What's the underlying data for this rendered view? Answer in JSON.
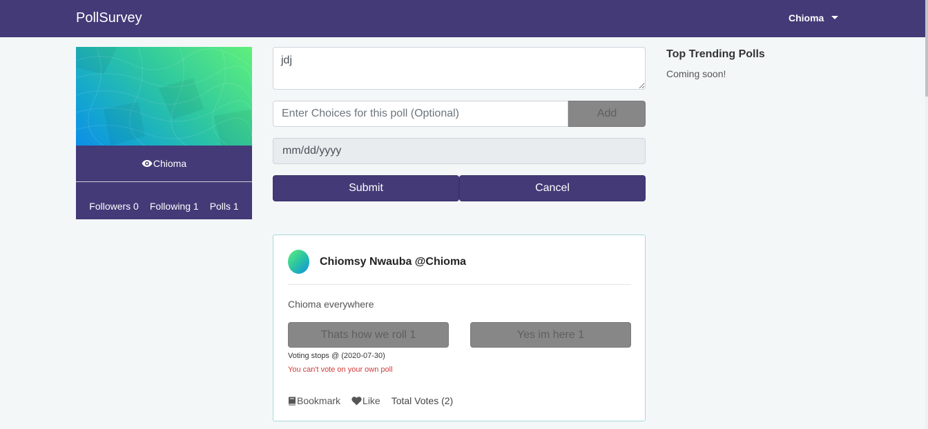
{
  "navbar": {
    "brand": "PollSurvey",
    "user": "Chioma",
    "bg_color": "#433a77"
  },
  "profile": {
    "name": "Chioma",
    "name_icon": "eye-icon",
    "followers_label": "Followers 0",
    "following_label": "Following 1",
    "polls_label": "Polls 1"
  },
  "create_poll": {
    "question_value": "jdj",
    "choice_placeholder": "Enter Choices for this poll (Optional)",
    "add_label": "Add",
    "date_placeholder": "mm/dd/yyyy",
    "submit_label": "Submit",
    "cancel_label": "Cancel"
  },
  "poll": {
    "author": "Chiomsy Nwauba @Chioma",
    "question": "Chioma everywhere",
    "choices": [
      "Thats how we roll 1",
      "Yes im here 1"
    ],
    "voting_stops": "Voting stops @ (2020-07-30)",
    "own_poll_warning": "You can't vote on your own poll",
    "bookmark_label": "Bookmark",
    "bookmark_icon": "book-icon",
    "like_label": "Like",
    "like_icon": "heart-icon",
    "total_votes": "Total Votes (2)"
  },
  "trending": {
    "title": "Top Trending Polls",
    "subtitle": "Coming soon!"
  }
}
